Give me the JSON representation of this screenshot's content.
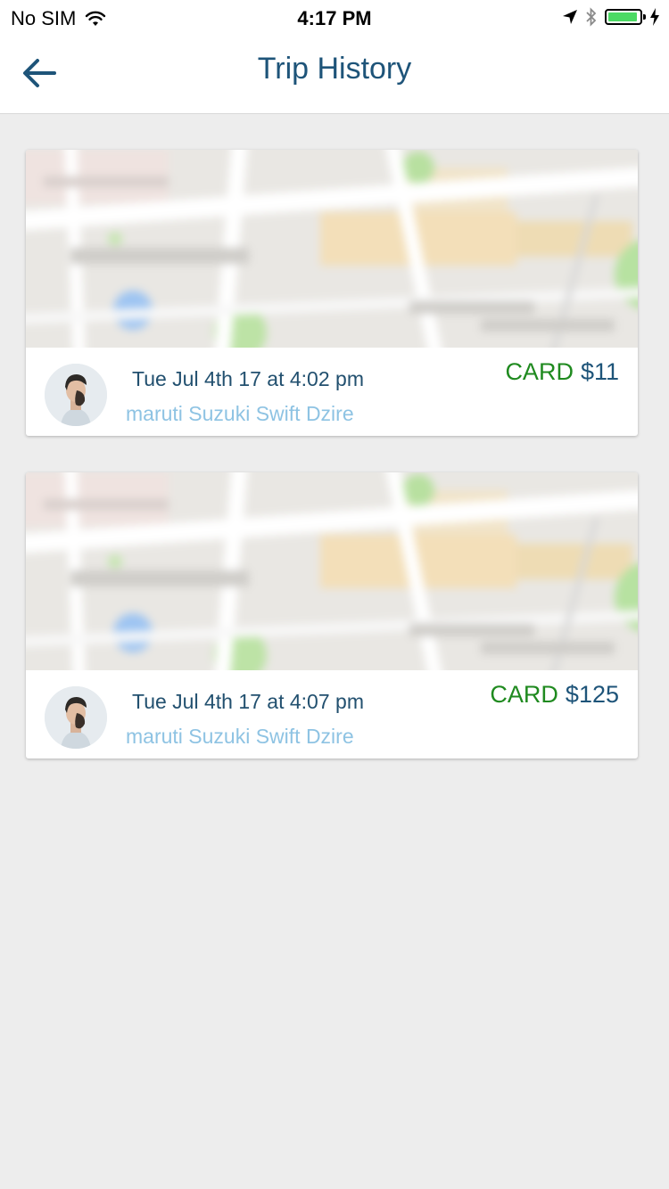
{
  "status_bar": {
    "carrier": "No SIM",
    "time": "4:17 PM",
    "battery_level": 0.95
  },
  "nav": {
    "title": "Trip History"
  },
  "colors": {
    "brand": "#1e5479",
    "fare_method": "#1f8a1f",
    "vehicle_text": "#8ec3e3",
    "background": "#ededed"
  },
  "trips": [
    {
      "date": "Tue Jul 4th 17 at 4:02 pm",
      "vehicle": "maruti Suzuki Swift Dzire",
      "payment_method": "CARD",
      "amount": "$11"
    },
    {
      "date": "Tue Jul 4th 17 at 4:07 pm",
      "vehicle": "maruti Suzuki Swift Dzire",
      "payment_method": "CARD",
      "amount": "$125"
    }
  ]
}
